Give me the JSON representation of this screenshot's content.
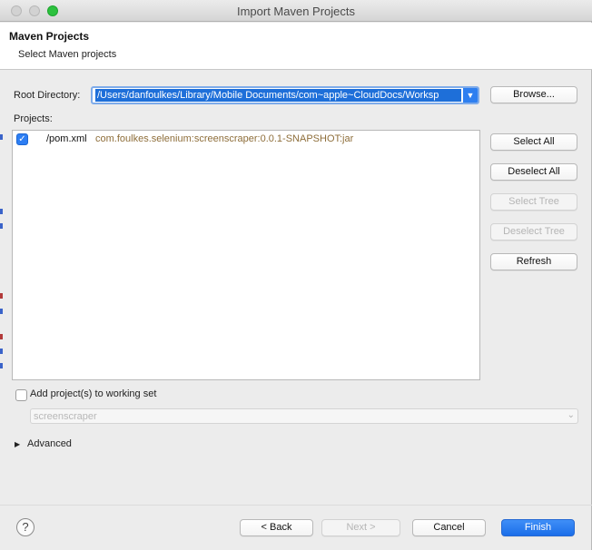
{
  "window": {
    "title": "Import Maven Projects"
  },
  "header": {
    "title": "Maven Projects",
    "subtitle": "Select Maven projects"
  },
  "root_directory": {
    "label": "Root Directory:",
    "value": "/Users/danfoulkes/Library/Mobile Documents/com~apple~CloudDocs/Worksp",
    "browse_label": "Browse..."
  },
  "projects": {
    "label": "Projects:",
    "items": [
      {
        "path": "/pom.xml",
        "artifact": "com.foulkes.selenium:screenscraper:0.0.1-SNAPSHOT:jar",
        "checked": true
      }
    ]
  },
  "side_buttons": {
    "select_all": "Select All",
    "deselect_all": "Deselect All",
    "select_tree": "Select Tree",
    "deselect_tree": "Deselect Tree",
    "refresh": "Refresh"
  },
  "working_set": {
    "checkbox_label": "Add project(s) to working set",
    "checked": false,
    "value": "screenscraper"
  },
  "advanced": {
    "label": "Advanced"
  },
  "footer": {
    "back_label": "< Back",
    "next_label": "Next >",
    "cancel_label": "Cancel",
    "finish_label": "Finish"
  },
  "colors": {
    "accent": "#1b6ee9",
    "artifact_text": "#8e6e3a"
  }
}
